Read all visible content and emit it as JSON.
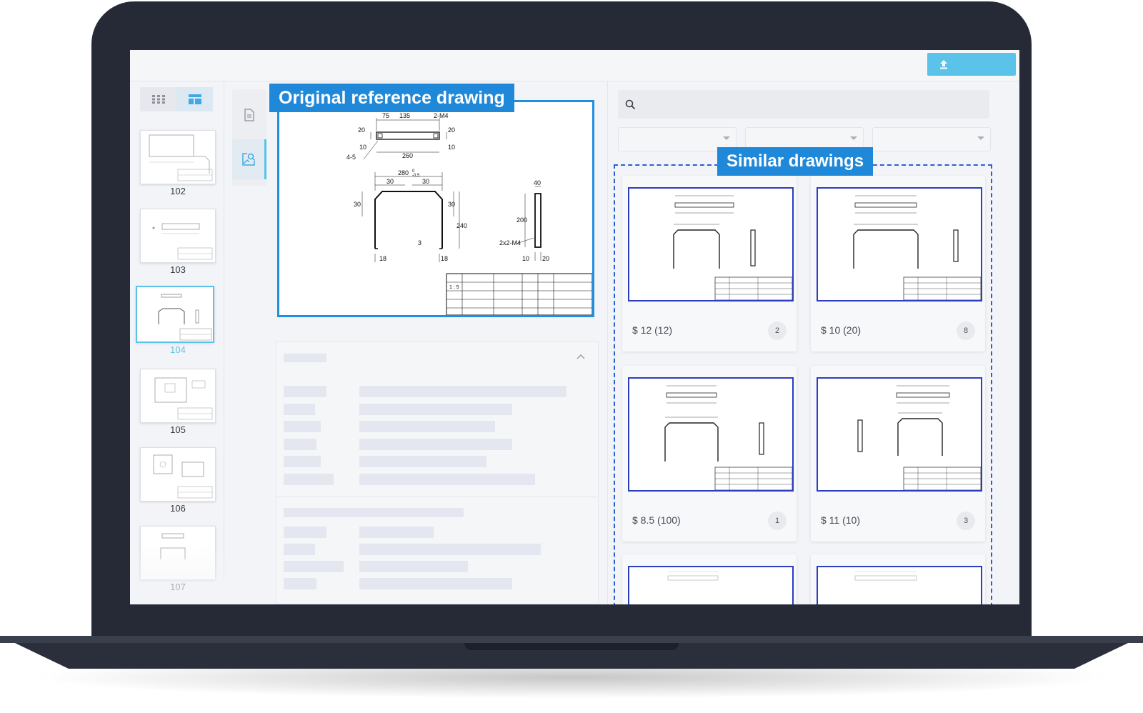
{
  "labels": {
    "original": "Original reference drawing",
    "similar": "Similar drawings"
  },
  "search": {
    "placeholder": ""
  },
  "thumbnails": [
    {
      "label": "102",
      "active": false
    },
    {
      "label": "103",
      "active": false
    },
    {
      "label": "104",
      "active": true
    },
    {
      "label": "105",
      "active": false
    },
    {
      "label": "106",
      "active": false
    },
    {
      "label": "107",
      "active": false
    }
  ],
  "reference_drawing": {
    "dims": {
      "d75": "75",
      "d135": "135",
      "m4": "2-M4",
      "d20a": "20",
      "d20b": "20",
      "d10a": "10",
      "d10b": "10",
      "d45": "4-5",
      "d260": "260",
      "d280": "280",
      "tol": "-0.5",
      "tol0": "0",
      "d30a": "30",
      "d30b": "30",
      "d30c": "30",
      "d30d": "30",
      "d240": "240",
      "d18a": "18",
      "d18b": "18",
      "d3": "3",
      "d40": "40",
      "d200": "200",
      "m4b": "2x2-M4",
      "d10c": "10",
      "d20c": "20"
    },
    "title_block": {
      "scale": "1 : 5"
    }
  },
  "results": [
    {
      "price": "$ 12 (12)",
      "badge": "2"
    },
    {
      "price": "$ 10 (20)",
      "badge": "8"
    },
    {
      "price": "$ 8.5 (100)",
      "badge": "1"
    },
    {
      "price": "$ 11 (10)",
      "badge": "3"
    },
    {
      "price": "",
      "badge": ""
    },
    {
      "price": "",
      "badge": ""
    }
  ],
  "colors": {
    "accent": "#5bc2ea",
    "label_blue": "#1f88d9",
    "dashed": "#2c5fd6",
    "bezel": "#262a36"
  },
  "icons": {
    "upload": "upload-icon",
    "search": "search-icon",
    "grid": "grid-view-icon",
    "list": "list-view-icon",
    "document": "document-icon",
    "image_search": "image-search-icon"
  }
}
